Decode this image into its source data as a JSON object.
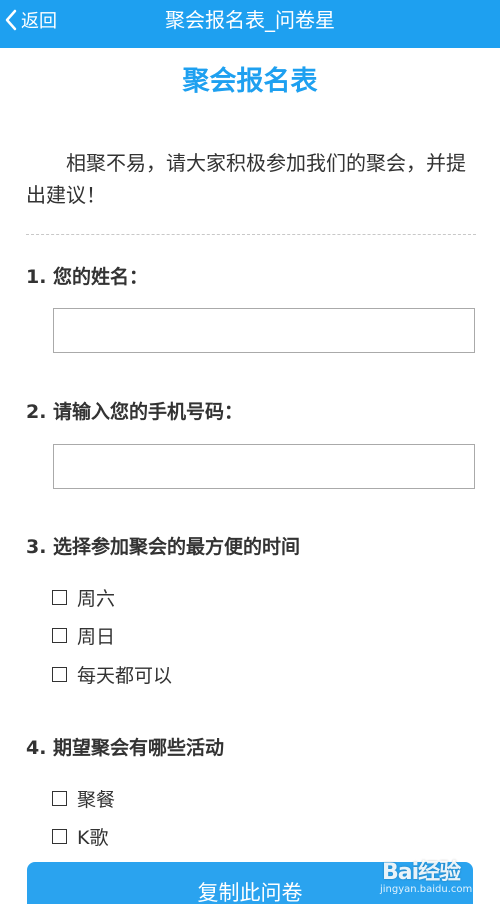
{
  "navbar": {
    "back_label": "返回",
    "title": "聚会报名表_问卷星",
    "background": "#1ea0f0"
  },
  "survey": {
    "title": "聚会报名表",
    "intro": "相聚不易，请大家积极参加我们的聚会，并提出建议！",
    "accent": "#1ea0f0"
  },
  "questions": [
    {
      "title": "1. 您的姓名：",
      "type": "text",
      "value": ""
    },
    {
      "title": "2. 请输入您的手机号码：",
      "type": "text",
      "value": ""
    },
    {
      "title": "3. 选择参加聚会的最方便的时间",
      "type": "checkbox",
      "options": [
        "周六",
        "周日",
        "每天都可以"
      ]
    },
    {
      "title": "4. 期望聚会有哪些活动",
      "type": "checkbox",
      "options": [
        "聚餐",
        "K歌"
      ]
    }
  ],
  "footer": {
    "copy_button_label": "复制此问卷"
  },
  "watermark": {
    "logo_text": "Bai经验",
    "url": "jingyan.baidu.com"
  }
}
